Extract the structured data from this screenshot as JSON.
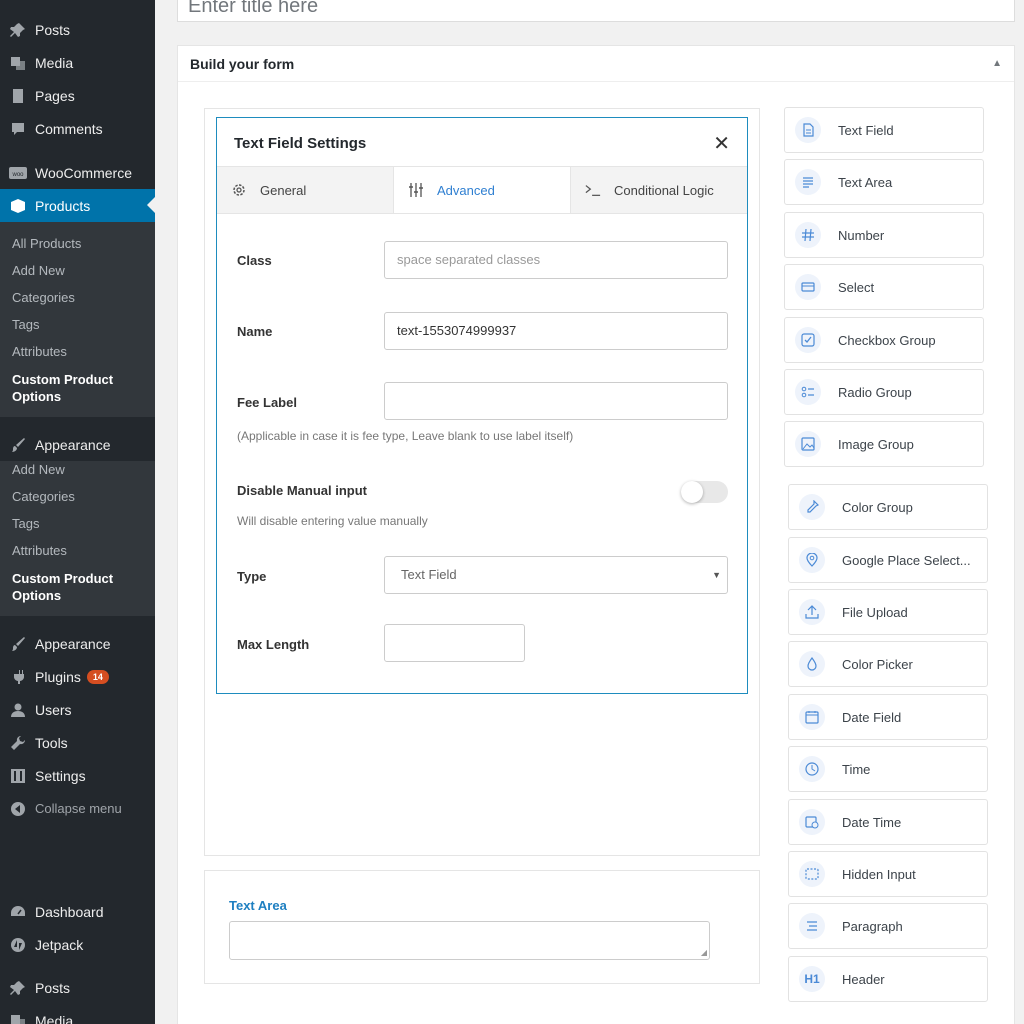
{
  "sidebar": {
    "posts": "Posts",
    "media": "Media",
    "pages": "Pages",
    "comments": "Comments",
    "woocommerce": "WooCommerce",
    "products": "Products",
    "products_sub": [
      "All Products",
      "Add New",
      "Categories",
      "Tags",
      "Attributes"
    ],
    "custom_product_options": "Custom Product Options",
    "appearance": "Appearance",
    "appearance_sub": [
      "Add New",
      "Categories",
      "Tags",
      "Attributes"
    ],
    "custom_product_options_2": "Custom Product Options",
    "appearance_2": "Appearance",
    "plugins": "Plugins",
    "plugins_badge": "14",
    "users": "Users",
    "tools": "Tools",
    "settings": "Settings",
    "collapse": "Collapse menu",
    "dashboard": "Dashboard",
    "jetpack": "Jetpack",
    "posts_2": "Posts",
    "media_2": "Media"
  },
  "title_input": {
    "placeholder": "Enter title here"
  },
  "panel": {
    "title": "Build your form"
  },
  "settings_modal": {
    "title": "Text Field Settings",
    "close": "✕",
    "tabs": {
      "general": "General",
      "advanced": "Advanced",
      "conditional": "Conditional Logic"
    },
    "class_label": "Class",
    "class_placeholder": "space separated classes",
    "name_label": "Name",
    "name_value": "text-1553074999937",
    "fee_label": "Fee Label",
    "fee_help": "(Applicable in case it is fee type, Leave blank to use label itself)",
    "disable_label": "Disable Manual input",
    "disable_help": "Will disable entering value manually",
    "disable_on": false,
    "type_label": "Type",
    "type_value": "Text Field",
    "maxlen_label": "Max Length"
  },
  "canvas_textarea": {
    "label": "Text Area"
  },
  "palette": {
    "fields": [
      "Text Field",
      "Text Area",
      "Number",
      "Select",
      "Checkbox Group",
      "Radio Group",
      "Image Group",
      "Color Group",
      "Google Place Select...",
      "File Upload",
      "Color Picker",
      "Date Field",
      "Time",
      "Date Time",
      "Hidden Input",
      "Paragraph",
      "Header"
    ],
    "header_icon_text": "H1"
  },
  "colors": {
    "sidebar_bg": "#23282d",
    "active": "#0073aa",
    "accent_blue": "#2f7fd1"
  }
}
